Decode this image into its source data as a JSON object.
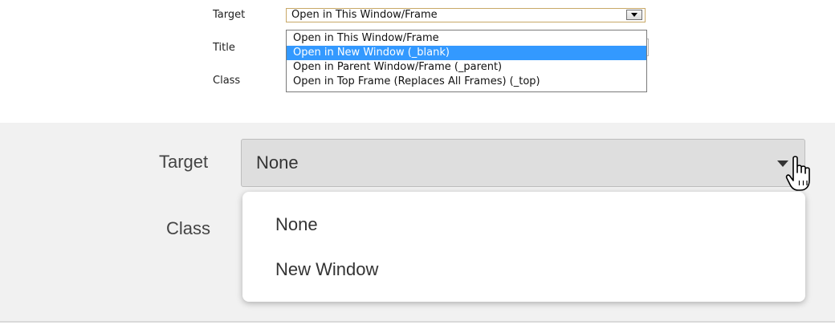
{
  "legacy_dialog": {
    "target_label": "Target",
    "title_label": "Title",
    "class_label": "Class",
    "target_selected": "Open in This Window/Frame",
    "options": [
      "Open in This Window/Frame",
      "Open in New Window (_blank)",
      "Open in Parent Window/Frame (_parent)",
      "Open in Top Frame (Replaces All Frames) (_top)"
    ],
    "highlighted_option": "Open in New Window (_blank)"
  },
  "modern_dialog": {
    "target_label": "Target",
    "class_label": "Class",
    "target_selected": "None",
    "options": [
      "None",
      "New Window"
    ]
  },
  "icons": {
    "legacy_dropdown_arrow": "triangle-down-icon",
    "modern_dropdown_caret": "caret-down-icon",
    "cursor": "hand-pointer-cursor-icon"
  },
  "colors": {
    "legacy_highlight": "#3399ff",
    "modern_panel_bg": "#f1f1f1",
    "modern_select_bg": "#dedede"
  }
}
